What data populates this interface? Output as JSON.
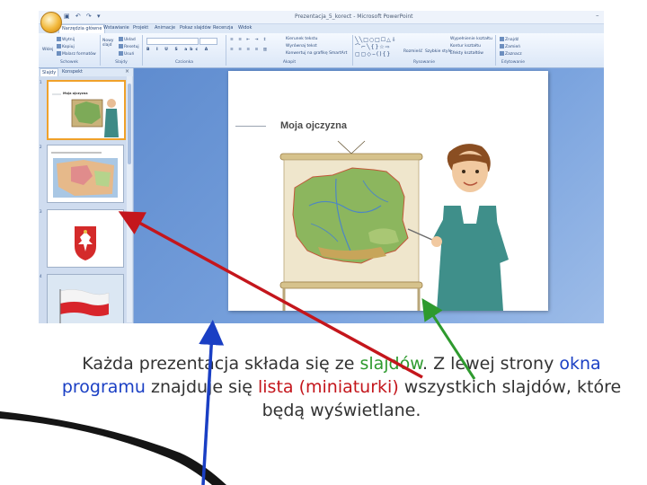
{
  "window": {
    "title": "Prezentacja_5_korect - Microsoft PowerPoint",
    "qat": "▣ ↶ ↷ ▾",
    "controls": "–"
  },
  "ribbon": {
    "tabs": [
      "Narzędzia główne",
      "Wstawianie",
      "Projekt",
      "Animacje",
      "Pokaz slajdów",
      "Recenzja",
      "Widok"
    ],
    "clipboard": {
      "paste": "Wklej",
      "cut": "Wytnij",
      "copy": "Kopiuj",
      "format_painter": "Malarz formatów",
      "label": "Schowek"
    },
    "slides": {
      "new_slide": "Nowy slajd",
      "layout": "Układ",
      "reset": "Resetuj",
      "delete": "Usuń",
      "label": "Slajdy"
    },
    "font": {
      "label": "Czcionka"
    },
    "paragraph": {
      "text_direction": "Kierunek tekstu",
      "align_text": "Wyrównaj tekst",
      "smartart": "Konwertuj na grafikę SmartArt",
      "label": "Akapit"
    },
    "drawing": {
      "arrange": "Rozmieść",
      "quick_styles": "Szybkie style",
      "shape_fill": "Wypełnienie kształtu",
      "shape_outline": "Kontur kształtu",
      "shape_effects": "Efekty kształtów",
      "label": "Rysowanie"
    },
    "editing": {
      "find": "Znajdź",
      "replace": "Zamień",
      "select": "Zaznacz",
      "label": "Edytowanie"
    }
  },
  "slides_panel": {
    "tab_slides": "Slajdy",
    "tab_outline": "Konspekt",
    "close": "×",
    "thumbs": [
      {
        "num": "1",
        "title": "Moja ojczyzna"
      },
      {
        "num": "2",
        "title": ""
      },
      {
        "num": "3",
        "title": ""
      },
      {
        "num": "4",
        "title": ""
      }
    ]
  },
  "slide": {
    "title": "Moja ojczyzna"
  },
  "caption": {
    "p1": "Każda prezentacja składa się ze ",
    "slides": "slajdów",
    "p2": ". Z lewej strony ",
    "window": "okna programu",
    "p3": " znajduje się ",
    "list": "lista (miniaturki)",
    "p4": " wszystkich slajdów,  które będą wyświetlane."
  },
  "colors": {
    "accent_green": "#2e9a2e",
    "accent_blue": "#1a3fc4",
    "accent_red": "#c4161c",
    "ribbon_bg": "#dbe7f7",
    "slide_area": "#6f99d9",
    "thumb_selected": "#f0a12a"
  },
  "icons": [
    "office-button-icon",
    "arrow-blue-icon",
    "arrow-red-icon",
    "arrow-green-icon"
  ]
}
